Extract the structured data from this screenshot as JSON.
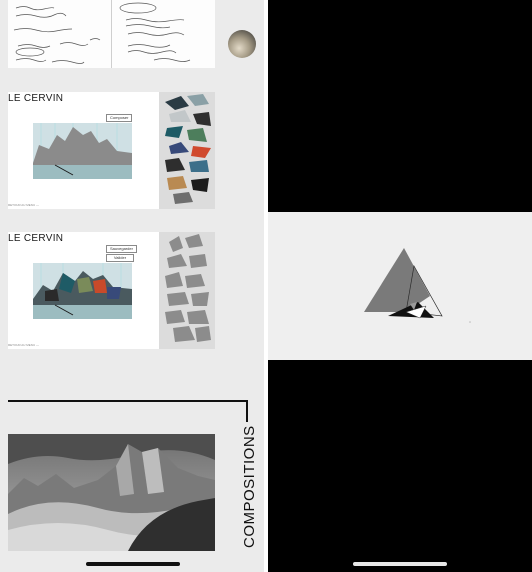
{
  "left_screen": {
    "card1": {
      "title": "LE CERVIN",
      "button_label": "Composer",
      "footer": "RETOUR AU MENU  —"
    },
    "card2": {
      "title": "LE CERVIN",
      "button_labels": [
        "Sauvegarder",
        "Valider"
      ],
      "footer": "RETOUR AU MENU  —"
    },
    "section_label": "COMPOSITIONS"
  },
  "colors": {
    "left_background": "#ebebeb",
    "right_background": "#000000",
    "modal_band": "#efefef",
    "triangle": "#7a7a7a"
  }
}
